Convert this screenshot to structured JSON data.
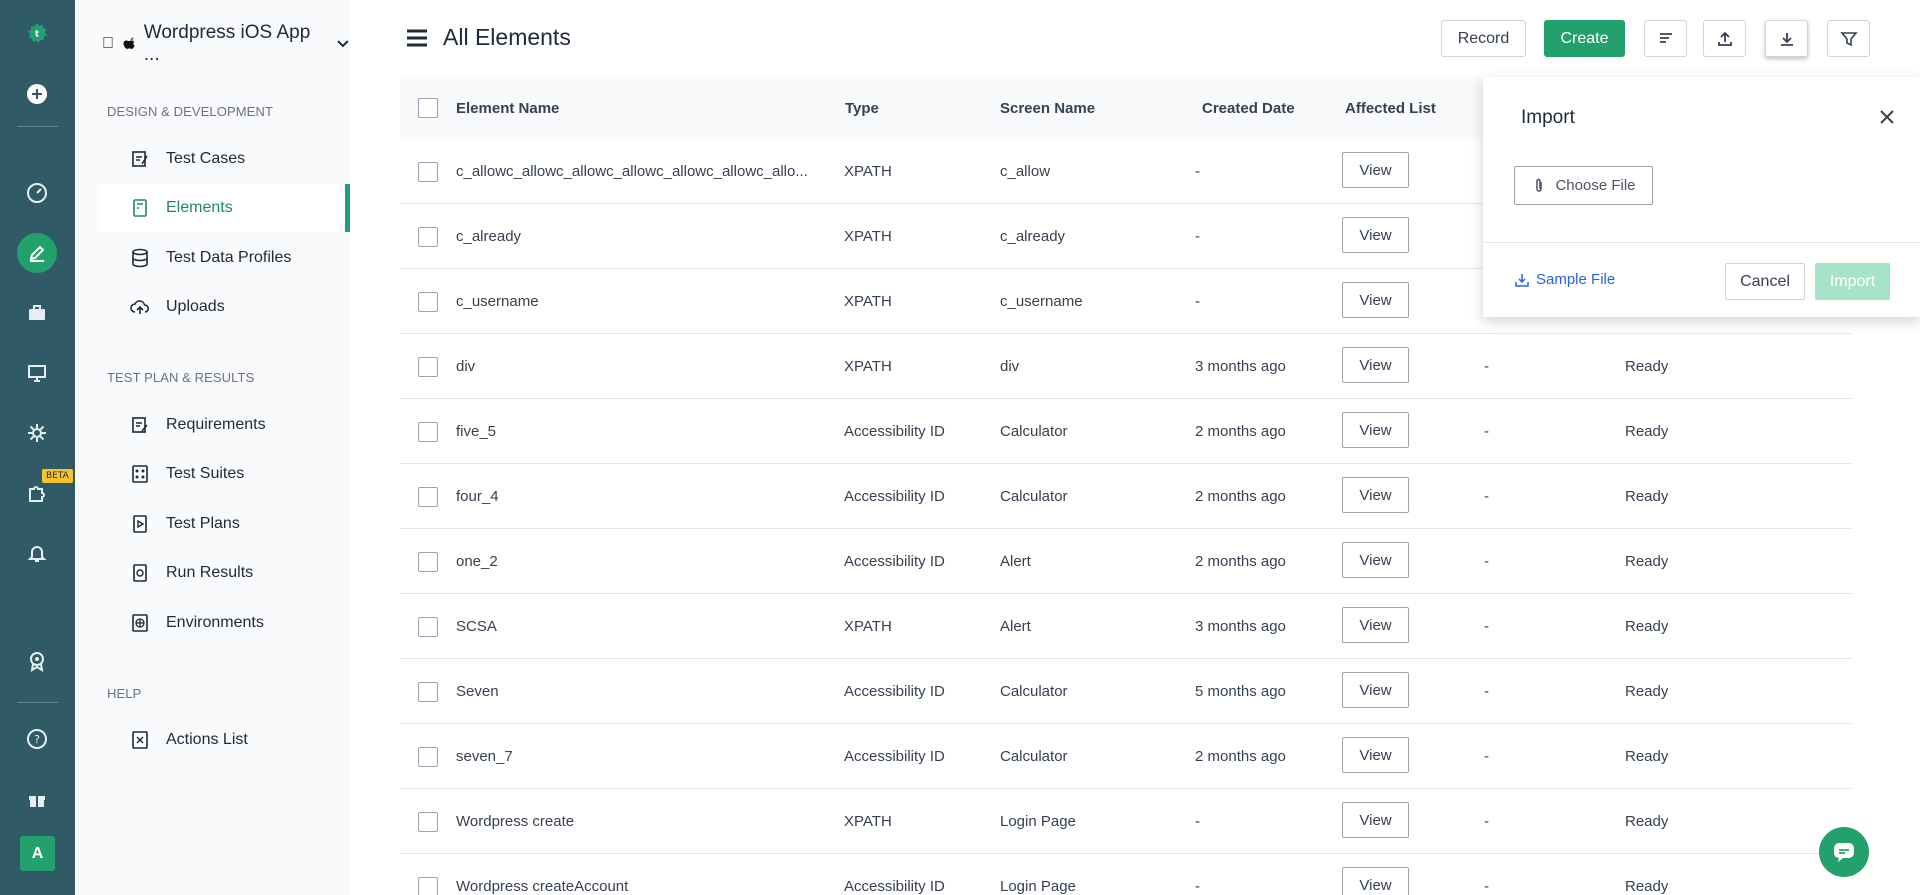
{
  "rail": {
    "logo": "testsigma-logo",
    "items": [
      "add-icon",
      "dashboard-icon",
      "design-icon",
      "briefcase-icon",
      "monitor-icon",
      "settings-icon",
      "puzzle-icon",
      "bell-icon",
      "badge-icon",
      "help-icon",
      "gift-icon"
    ],
    "beta_label": "BETA",
    "avatar_letter": "A"
  },
  "sidebar": {
    "project_name": "Wordpress iOS App ...",
    "sections": [
      {
        "title": "DESIGN & DEVELOPMENT",
        "items": [
          "Test Cases",
          "Elements",
          "Test Data Profiles",
          "Uploads"
        ]
      },
      {
        "title": "TEST PLAN & RESULTS",
        "items": [
          "Requirements",
          "Test Suites",
          "Test Plans",
          "Run Results",
          "Environments"
        ]
      },
      {
        "title": "HELP",
        "items": [
          "Actions List"
        ]
      }
    ],
    "active_item": "Elements"
  },
  "header": {
    "title": "All Elements",
    "record_label": "Record",
    "create_label": "Create"
  },
  "table": {
    "columns": [
      "Element Name",
      "Type",
      "Screen Name",
      "Created Date",
      "Affected List"
    ],
    "view_label": "View",
    "rows": [
      {
        "name": "c_allowc_allowc_allowc_allowc_allowc_allowc_allo...",
        "type": "XPATH",
        "screen": "c_allow",
        "created": "-",
        "affected": "",
        "status": ""
      },
      {
        "name": "c_already",
        "type": "XPATH",
        "screen": "c_already",
        "created": "-",
        "affected": "",
        "status": ""
      },
      {
        "name": "c_username",
        "type": "XPATH",
        "screen": "c_username",
        "created": "-",
        "affected": "",
        "status": ""
      },
      {
        "name": "div",
        "type": "XPATH",
        "screen": "div",
        "created": "3 months ago",
        "affected": "-",
        "status": "Ready"
      },
      {
        "name": "five_5",
        "type": "Accessibility ID",
        "screen": "Calculator",
        "created": "2 months ago",
        "affected": "-",
        "status": "Ready"
      },
      {
        "name": "four_4",
        "type": "Accessibility ID",
        "screen": "Calculator",
        "created": "2 months ago",
        "affected": "-",
        "status": "Ready"
      },
      {
        "name": "one_2",
        "type": "Accessibility ID",
        "screen": "Alert",
        "created": "2 months ago",
        "affected": "-",
        "status": "Ready"
      },
      {
        "name": "SCSA",
        "type": "XPATH",
        "screen": "Alert",
        "created": "3 months ago",
        "affected": "-",
        "status": "Ready"
      },
      {
        "name": "Seven",
        "type": "Accessibility ID",
        "screen": "Calculator",
        "created": "5 months ago",
        "affected": "-",
        "status": "Ready"
      },
      {
        "name": "seven_7",
        "type": "Accessibility ID",
        "screen": "Calculator",
        "created": "2 months ago",
        "affected": "-",
        "status": "Ready"
      },
      {
        "name": "Wordpress create",
        "type": "XPATH",
        "screen": "Login Page",
        "created": "-",
        "affected": "-",
        "status": "Ready"
      },
      {
        "name": "Wordpress createAccount",
        "type": "Accessibility ID",
        "screen": "Login Page",
        "created": "-",
        "affected": "-",
        "status": "Ready"
      }
    ]
  },
  "import_popover": {
    "title": "Import",
    "choose_file_label": "Choose File",
    "sample_file_label": "Sample File",
    "cancel_label": "Cancel",
    "import_label": "Import"
  },
  "colors": {
    "rail_bg": "#2f5a66",
    "accent": "#23a16d",
    "link": "#2563eb"
  }
}
